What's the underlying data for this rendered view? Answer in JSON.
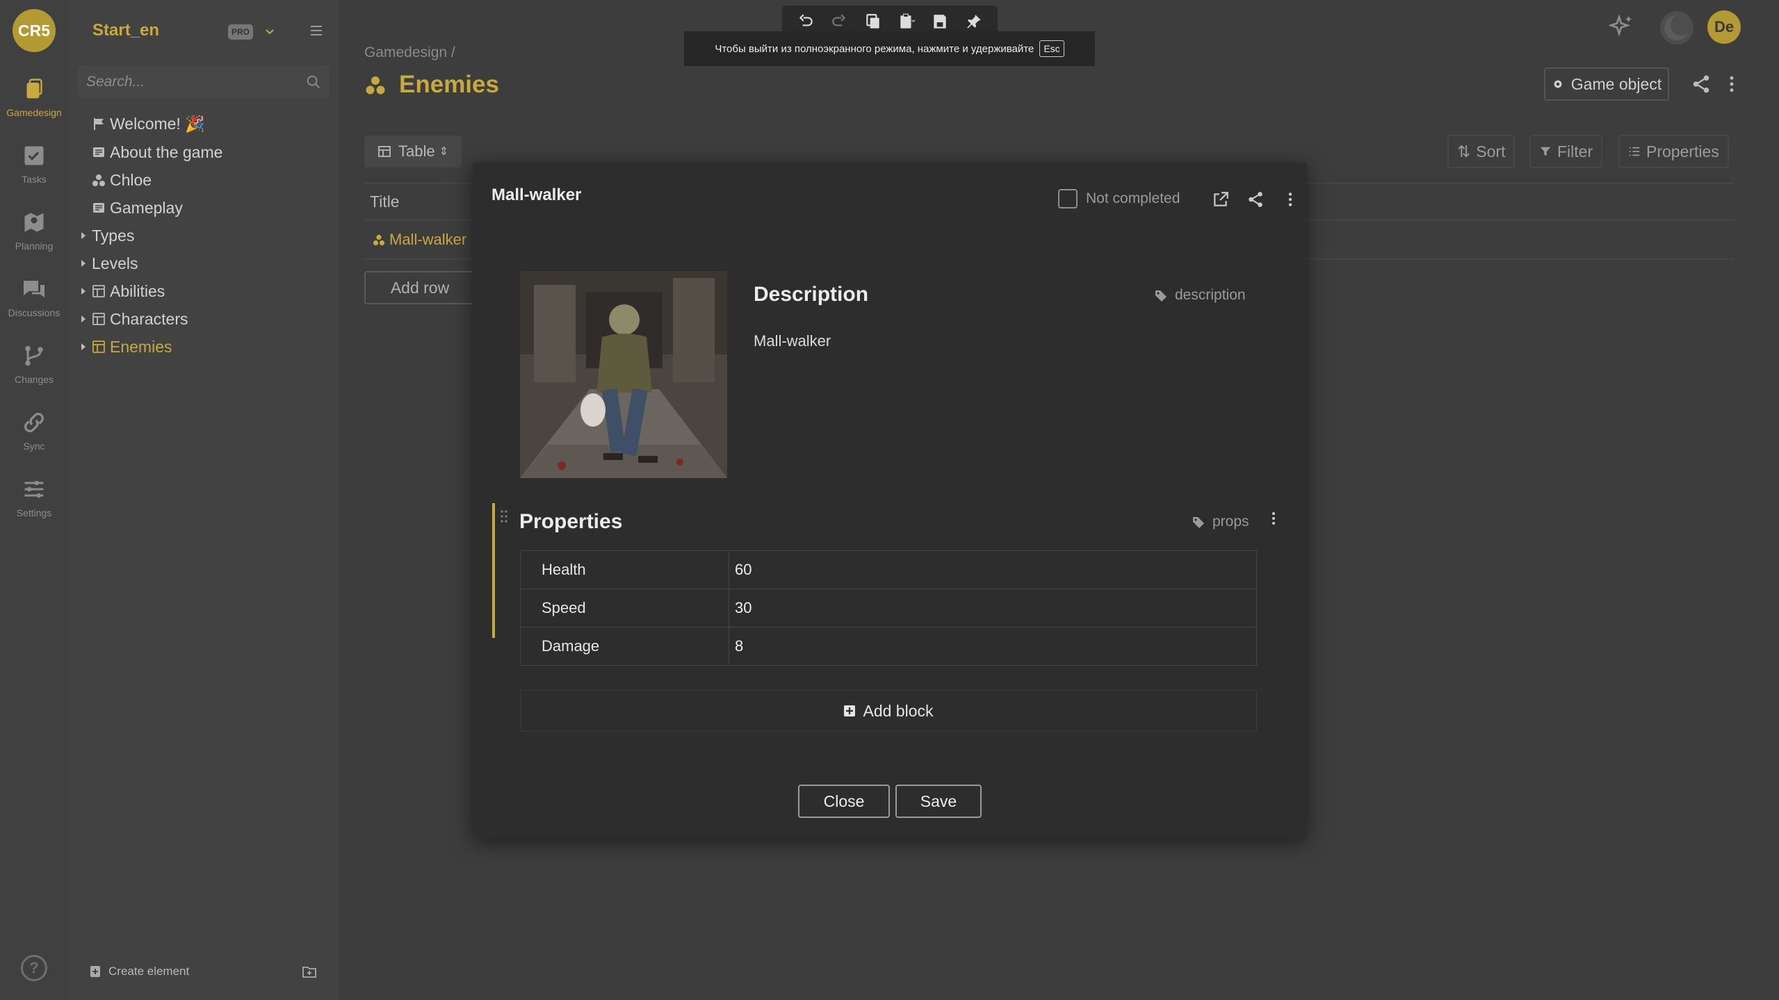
{
  "rail": {
    "logo": "CR5",
    "items": [
      {
        "label": "Gamedesign",
        "icon": "gamedesign-icon",
        "active": true
      },
      {
        "label": "Tasks",
        "icon": "tasks-icon"
      },
      {
        "label": "Planning",
        "icon": "planning-icon"
      },
      {
        "label": "Discussions",
        "icon": "discussions-icon"
      },
      {
        "label": "Changes",
        "icon": "changes-icon"
      },
      {
        "label": "Sync",
        "icon": "sync-icon"
      },
      {
        "label": "Settings",
        "icon": "settings-icon"
      }
    ],
    "help": "?"
  },
  "sidebar": {
    "project_name": "Start_en",
    "badge": "PRO",
    "search_placeholder": "Search...",
    "tree": [
      {
        "label": "Welcome! 🎉",
        "icon": "flag-icon"
      },
      {
        "label": "About the game",
        "icon": "doc-icon"
      },
      {
        "label": "Chloe",
        "icon": "character-icon"
      },
      {
        "label": "Gameplay",
        "icon": "doc-icon"
      },
      {
        "label": "Types",
        "expandable": true
      },
      {
        "label": "Levels",
        "expandable": true
      },
      {
        "label": "Abilities",
        "expandable": true,
        "icon": "table-folder-icon"
      },
      {
        "label": "Characters",
        "expandable": true,
        "icon": "table-folder-icon"
      },
      {
        "label": "Enemies",
        "expandable": true,
        "icon": "table-folder-icon",
        "active": true
      }
    ],
    "create_label": "Create element"
  },
  "main": {
    "breadcrumb": "Gamedesign /",
    "title": "Enemies",
    "game_object_label": "Game object",
    "view_label": "Table",
    "sort_label": "Sort",
    "filter_label": "Filter",
    "properties_label": "Properties",
    "column_title": "Title",
    "row_title": "Mall-walker",
    "add_row_label": "Add row",
    "avatar_initials": "De"
  },
  "toast": {
    "text": "Чтобы выйти из полноэкранного режима, нажмите и удерживайте",
    "key": "Esc"
  },
  "modal": {
    "title": "Mall-walker",
    "status_label": "Not completed",
    "description": {
      "heading": "Description",
      "tag": "description",
      "text": "Mall-walker"
    },
    "properties": {
      "heading": "Properties",
      "tag": "props",
      "rows": [
        {
          "key": "Health",
          "value": "60"
        },
        {
          "key": "Speed",
          "value": "30"
        },
        {
          "key": "Damage",
          "value": "8"
        }
      ]
    },
    "add_block_label": "Add block",
    "close_label": "Close",
    "save_label": "Save"
  },
  "colors": {
    "accent": "#c7a93d",
    "modal_bg": "#2d2d2d",
    "page_bg": "#3d3d3d"
  }
}
